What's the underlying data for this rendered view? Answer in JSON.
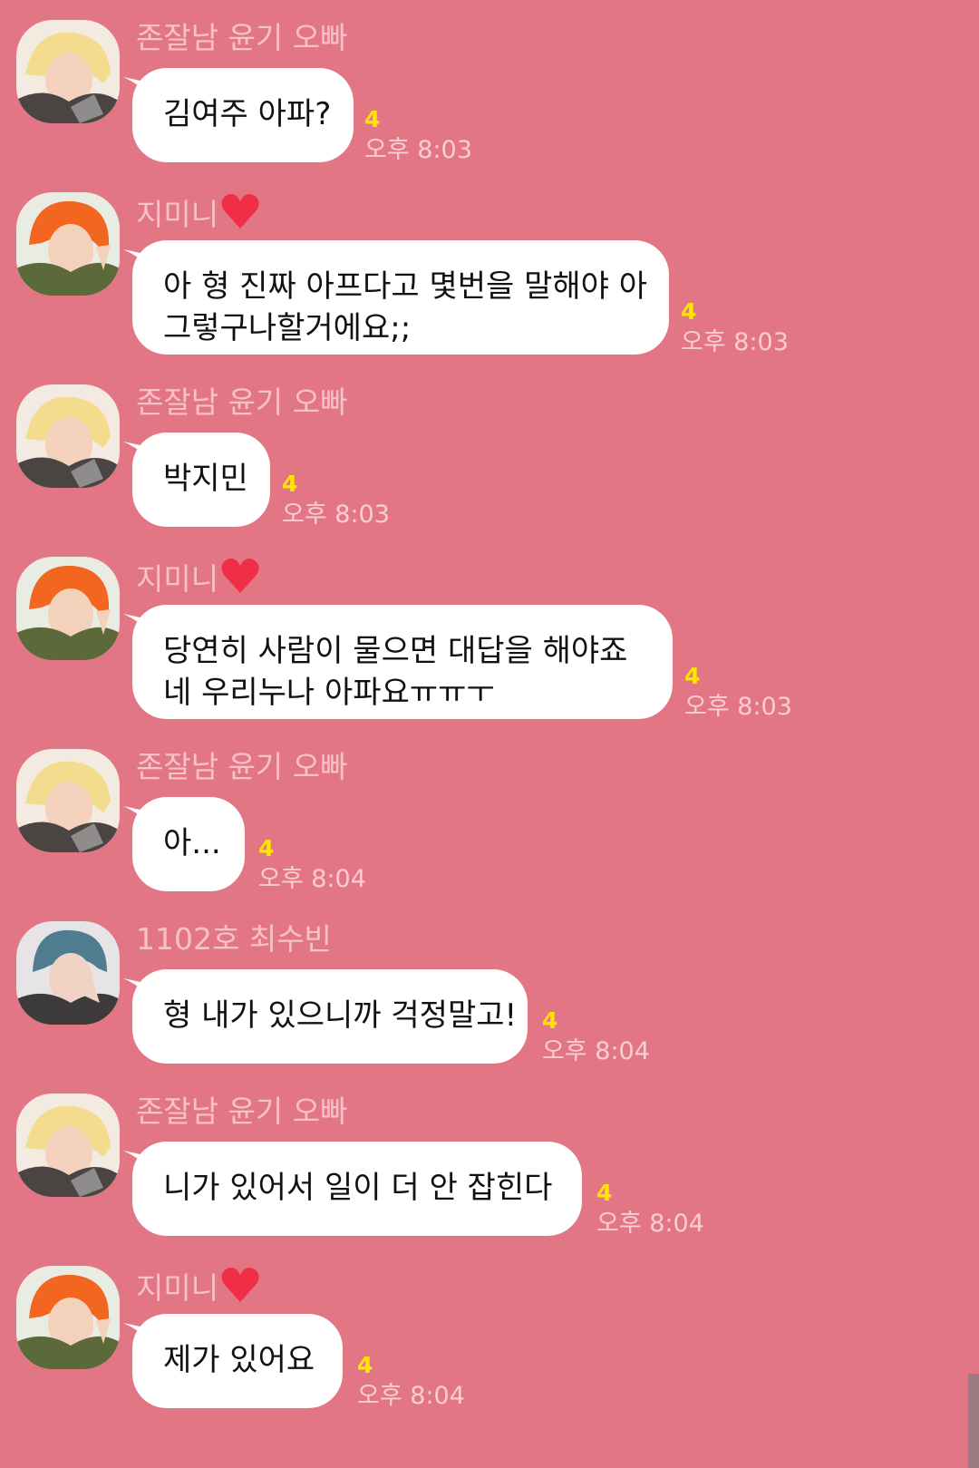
{
  "colors": {
    "background": "#e37684",
    "bubble": "#ffffff",
    "sender_name": "#f7c2c7",
    "unread_count": "#ffe600",
    "timestamp": "#f9cdd2"
  },
  "messages": [
    {
      "sender": "존잘남 윤기 오빠",
      "sender_heart": false,
      "avatar": "yoongi-avatar",
      "lines": [
        "김여주 아파?"
      ],
      "unread": "4",
      "time": "오후 8:03"
    },
    {
      "sender": "지미니",
      "sender_heart": true,
      "avatar": "jimin-avatar",
      "lines": [
        "아 형 진짜 아프다고 몇번을 말해야 아",
        "그렇구나할거에요;;"
      ],
      "unread": "4",
      "time": "오후 8:03"
    },
    {
      "sender": "존잘남 윤기 오빠",
      "sender_heart": false,
      "avatar": "yoongi-avatar",
      "lines": [
        "박지민"
      ],
      "unread": "4",
      "time": "오후 8:03"
    },
    {
      "sender": "지미니",
      "sender_heart": true,
      "avatar": "jimin-avatar",
      "lines": [
        "당연히 사람이 물으면 대답을 해야죠",
        "네 우리누나 아파요ㅠㅠㅜ"
      ],
      "unread": "4",
      "time": "오후 8:03"
    },
    {
      "sender": "존잘남 윤기 오빠",
      "sender_heart": false,
      "avatar": "yoongi-avatar",
      "lines": [
        "아..."
      ],
      "unread": "4",
      "time": "오후 8:04"
    },
    {
      "sender": "1102호 최수빈",
      "sender_heart": false,
      "avatar": "soobin-avatar",
      "lines": [
        "형 내가 있으니까 걱정말고!"
      ],
      "unread": "4",
      "time": "오후 8:04"
    },
    {
      "sender": "존잘남 윤기 오빠",
      "sender_heart": false,
      "avatar": "yoongi-avatar",
      "lines": [
        "니가 있어서 일이 더 안 잡힌다"
      ],
      "unread": "4",
      "time": "오후 8:04"
    },
    {
      "sender": "지미니",
      "sender_heart": true,
      "avatar": "jimin-avatar",
      "lines": [
        "제가 있어요"
      ],
      "unread": "4",
      "time": "오후 8:04"
    }
  ]
}
